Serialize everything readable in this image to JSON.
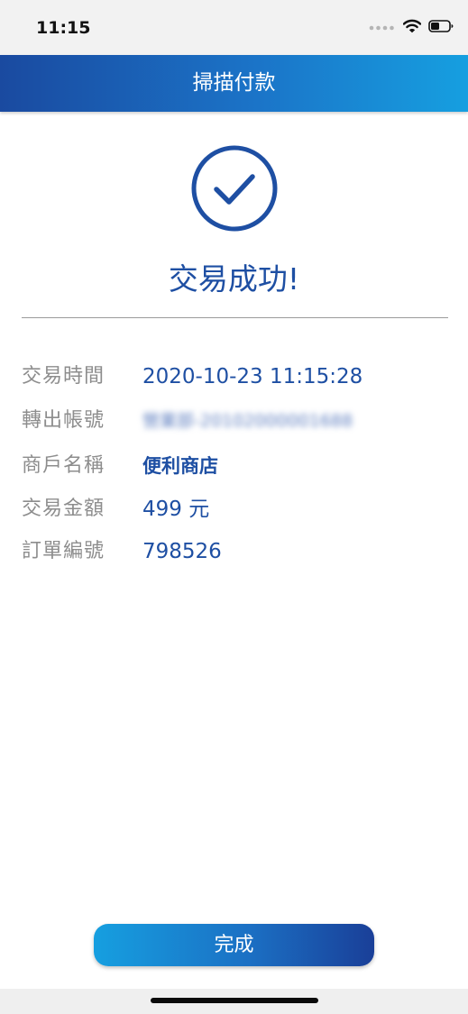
{
  "status_bar": {
    "time": "11:15",
    "icons": [
      "signal-dots-icon",
      "wifi-icon",
      "battery-icon"
    ]
  },
  "header": {
    "title": "掃描付款"
  },
  "result": {
    "icon": "check-circle-icon",
    "message": "交易成功!"
  },
  "details": [
    {
      "label": "交易時間",
      "value": "2020-10-23 11:15:28"
    },
    {
      "label": "轉出帳號",
      "value": "營業部-20102000001688"
    },
    {
      "label": "商戶名稱",
      "value": "便利商店"
    },
    {
      "label": "交易金額",
      "value": "499 元"
    },
    {
      "label": "訂單編號",
      "value": "798526"
    }
  ],
  "actions": {
    "done_label": "完成"
  },
  "colors": {
    "accent": "#1e4fa3",
    "header_gradient_start": "#1a4aa0",
    "header_gradient_end": "#169fe0",
    "label_gray": "#8d8d8d"
  }
}
